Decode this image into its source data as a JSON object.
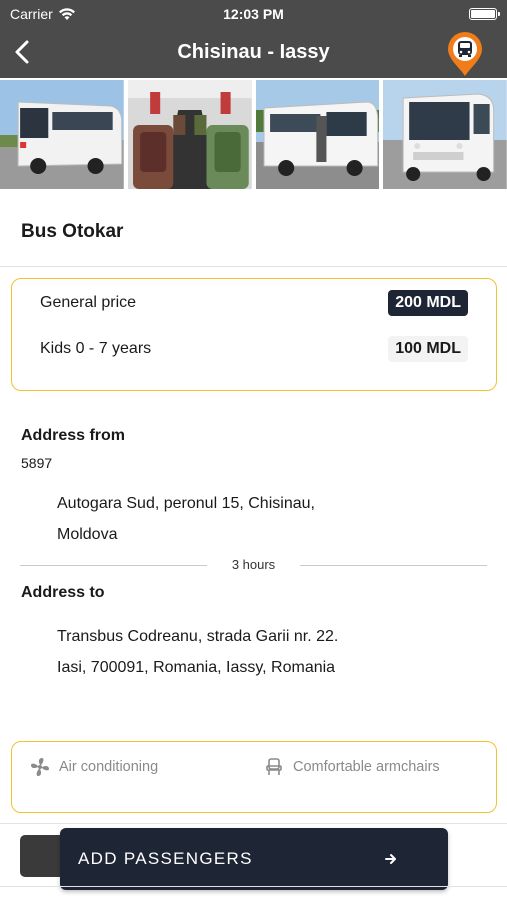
{
  "status_bar": {
    "carrier": "Carrier",
    "time": "12:03 PM"
  },
  "nav": {
    "title": "Chisinau - Iassy",
    "back_icon": "chevron-left-icon",
    "map_icon": "bus-map-pin-icon"
  },
  "colors": {
    "nav_bg": "#4b4b4b",
    "accent": "#f1c232",
    "pin_orange": "#f07d1a",
    "dark_button": "#1e2535"
  },
  "photos": [
    "bus-exterior-photo",
    "bus-interior-photo",
    "bus-side-photo",
    "bus-front-photo"
  ],
  "bus": {
    "name": "Bus Otokar"
  },
  "prices": [
    {
      "label": "General price",
      "value": "200 MDL",
      "style": "dark"
    },
    {
      "label": "Kids 0 - 7 years",
      "value": "100 MDL",
      "style": "light"
    }
  ],
  "address_from": {
    "heading": "Address from",
    "code": "5897",
    "line1": "Autogara Sud, peronul 15, Chisinau,",
    "line2": "Moldova"
  },
  "duration": "3 hours",
  "address_to": {
    "heading": "Address to",
    "line1": "Transbus Codreanu, strada Garii nr. 22.",
    "line2": "Iasi, 700091, Romania, Iassy, Romania"
  },
  "amenities": [
    {
      "label": "Air conditioning",
      "icon": "fan-icon"
    },
    {
      "label": "Comfortable armchairs",
      "icon": "armchair-icon"
    }
  ],
  "action": {
    "label": "ADD PASSENGERS",
    "icon": "arrow-right-icon"
  }
}
